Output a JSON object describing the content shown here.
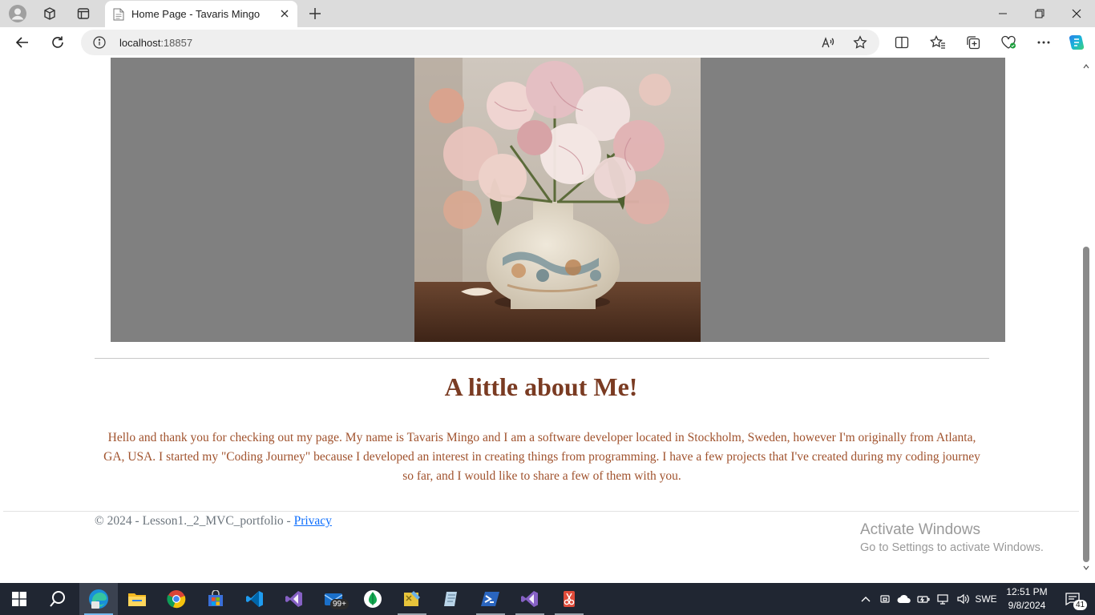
{
  "browser": {
    "tab_title": "Home Page - Tavaris Mingo",
    "url_host": "localhost",
    "url_port": ":18857"
  },
  "page": {
    "about_heading": "A little about Me!",
    "about_text": "Hello and thank you for checking out my page. My name is Tavaris Mingo and I am a software developer located in Stockholm, Sweden, however I'm originally from Atlanta, GA, USA. I started my \"Coding Journey\" because I developed an interest in creating things from programming. I have a few projects that I've created during my coding journey so far, and I would like to share a few of them with you.",
    "footer_prefix": "© 2024 - Lesson1._2_MVC_portfolio - ",
    "footer_link": "Privacy"
  },
  "watermark": {
    "line1": "Activate Windows",
    "line2": "Go to Settings to activate Windows."
  },
  "taskbar": {
    "mail_badge": "99+",
    "language": "SWE",
    "time": "12:51 PM",
    "date": "9/8/2024",
    "notification_count": "41"
  },
  "colors": {
    "heading": "#7a3b22",
    "body_text": "#a0522d",
    "hero_bg": "#808080",
    "link": "#0d6efd"
  }
}
